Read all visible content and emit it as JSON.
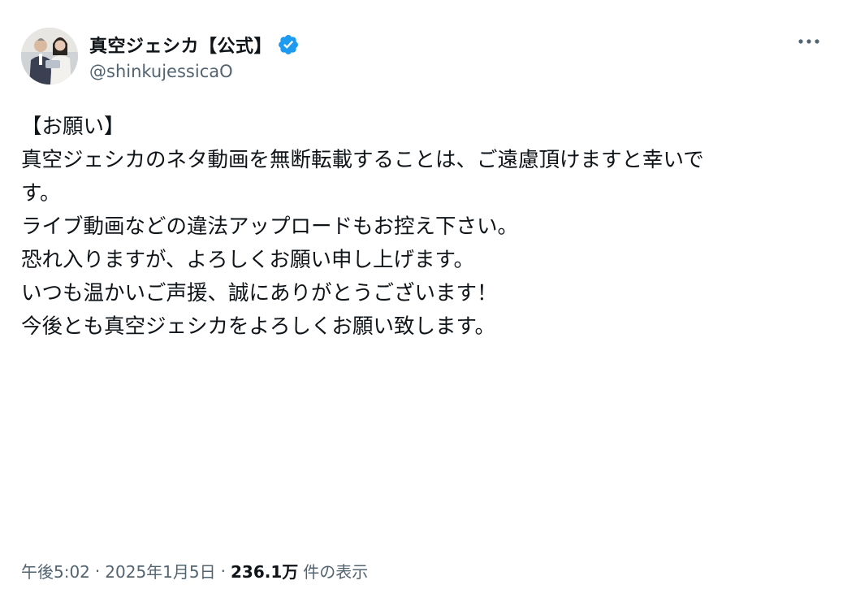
{
  "author": {
    "display_name": "真空ジェシカ【公式】",
    "handle": "@shinkujessicaO",
    "verified": true,
    "verified_color": "#1d9bf0"
  },
  "more_icon": "more-horizontal-icon",
  "tweet": {
    "lines": [
      "【お願い】",
      "",
      "真空ジェシカのネタ動画を無断転載することは、ご遠慮頂けますと幸いで",
      "す。",
      "",
      "ライブ動画などの違法アップロードもお控え下さい。",
      "",
      "恐れ入りますが、よろしくお願い申し上げます。",
      "",
      "いつも温かいご声援、誠にありがとうございます！",
      "",
      "今後とも真空ジェシカをよろしくお願い致します。"
    ]
  },
  "meta": {
    "time": "午後5:02",
    "date": "2025年1月5日",
    "views_count": "236.1万",
    "views_label": "件の表示",
    "separator": "·"
  }
}
